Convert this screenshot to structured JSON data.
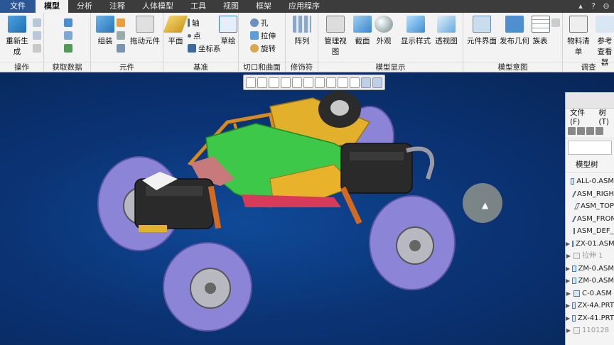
{
  "menubar": {
    "tabs": [
      "文件",
      "模型",
      "分析",
      "注释",
      "人体模型",
      "工具",
      "视图",
      "框架",
      "应用程序"
    ],
    "active_index": 1
  },
  "ribbon": {
    "groups": [
      {
        "label": "操作",
        "big": [
          "重新生成"
        ]
      },
      {
        "label": "获取数据",
        "big": []
      },
      {
        "label": "元件",
        "big": [
          "组装",
          "拖动元件"
        ]
      },
      {
        "label": "基准",
        "big": [
          "平面",
          "草绘"
        ],
        "small": [
          "轴",
          "点",
          "坐标系"
        ]
      },
      {
        "label": "切口和曲面",
        "small": [
          "孔",
          "拉伸",
          "旋转"
        ]
      },
      {
        "label": "修饰符",
        "big": [
          "阵列"
        ]
      },
      {
        "label": "模型显示",
        "big": [
          "管理视图",
          "截面",
          "外观",
          "显示样式",
          "透视图"
        ]
      },
      {
        "label": "模型意图",
        "big": [
          "元件界面",
          "发布几何",
          "族表"
        ]
      },
      {
        "label": "调查",
        "big": [
          "物料清单",
          "参考查看器"
        ]
      }
    ]
  },
  "panel": {
    "menu": [
      "文件(F)",
      "树(T)"
    ],
    "title": "模型树",
    "items": [
      {
        "label": "ALL-0.ASM",
        "icon": "assembly-icon",
        "arrow": ""
      },
      {
        "label": "ASM_RIGHT",
        "icon": "datum-plane-icon",
        "arrow": ""
      },
      {
        "label": "ASM_TOP",
        "icon": "datum-plane-icon",
        "arrow": ""
      },
      {
        "label": "ASM_FRONT",
        "icon": "datum-plane-icon",
        "arrow": ""
      },
      {
        "label": "ASM_DEF_CSYS",
        "icon": "csys-icon",
        "arrow": ""
      },
      {
        "label": "ZX-01.ASM",
        "icon": "part-icon",
        "arrow": "▶"
      },
      {
        "label": "拉伸 1",
        "icon": "extrude-icon",
        "arrow": "▶",
        "gray": true
      },
      {
        "label": "ZM-0.ASM",
        "icon": "part-icon",
        "arrow": "▶"
      },
      {
        "label": "ZM-0.ASM",
        "icon": "part-icon",
        "arrow": "▶"
      },
      {
        "label": "C-0.ASM",
        "icon": "part-icon",
        "arrow": "▶"
      },
      {
        "label": "ZX-4A.PRT",
        "icon": "part-icon",
        "arrow": "▶"
      },
      {
        "label": "ZX-41.PRT",
        "icon": "part-icon",
        "arrow": "▶"
      },
      {
        "label": "110128",
        "icon": "part-icon",
        "arrow": "▶",
        "gray": true
      }
    ]
  },
  "colors": {
    "viewport_bg": "#0b3476",
    "body_green": "#3ec84a",
    "tire": "#8c84d6",
    "frame_orange": "#d98a1e",
    "engine": "#2a2a2a"
  }
}
